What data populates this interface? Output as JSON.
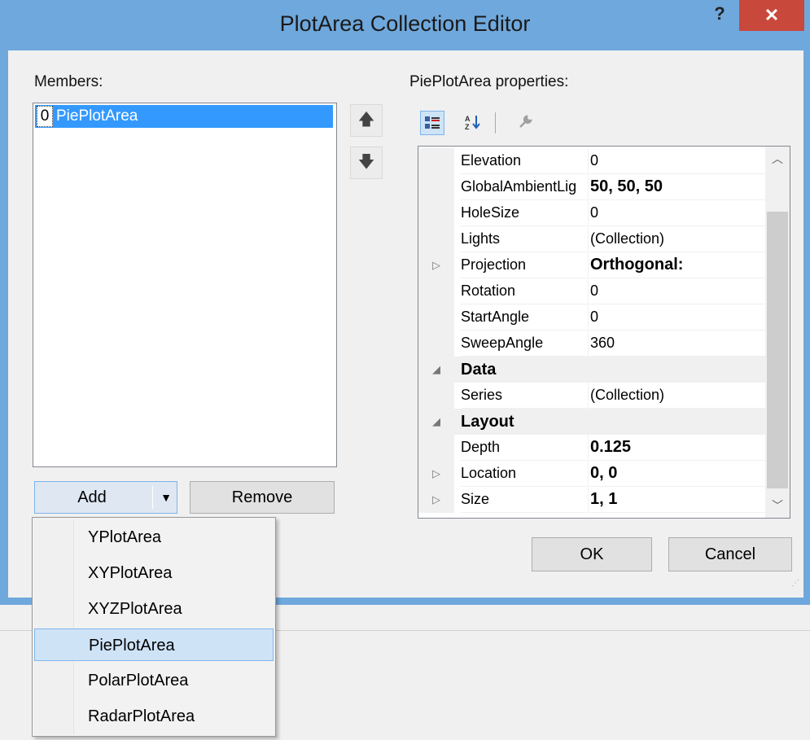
{
  "window": {
    "title": "PlotArea Collection Editor",
    "help_label": "?",
    "close_label": "✕"
  },
  "members": {
    "label": "Members:",
    "items": [
      {
        "index": "0",
        "name": "PiePlotArea"
      }
    ],
    "add_label": "Add",
    "add_dropdown_arrow": "▼",
    "remove_label": "Remove"
  },
  "properties": {
    "label": "PiePlotArea properties:",
    "toolbar": {
      "categorized_icon": "categorized-icon",
      "alphabetical_icon": "alphabetical-icon",
      "property_pages_icon": "wrench-icon"
    },
    "rows": [
      {
        "type": "prop",
        "name": "Elevation",
        "value": "0",
        "bold": false,
        "expander": ""
      },
      {
        "type": "prop",
        "name": "GlobalAmbientLig",
        "value": "50, 50, 50",
        "bold": true,
        "expander": ""
      },
      {
        "type": "prop",
        "name": "HoleSize",
        "value": "0",
        "bold": false,
        "expander": ""
      },
      {
        "type": "prop",
        "name": "Lights",
        "value": "(Collection)",
        "bold": false,
        "expander": ""
      },
      {
        "type": "prop",
        "name": "Projection",
        "value": "Orthogonal:",
        "bold": true,
        "expander": "▷"
      },
      {
        "type": "prop",
        "name": "Rotation",
        "value": "0",
        "bold": false,
        "expander": ""
      },
      {
        "type": "prop",
        "name": "StartAngle",
        "value": "0",
        "bold": false,
        "expander": ""
      },
      {
        "type": "prop",
        "name": "SweepAngle",
        "value": "360",
        "bold": false,
        "expander": ""
      },
      {
        "type": "category",
        "name": "Data",
        "expander": "◢"
      },
      {
        "type": "prop",
        "name": "Series",
        "value": "(Collection)",
        "bold": false,
        "expander": ""
      },
      {
        "type": "category",
        "name": "Layout",
        "expander": "◢"
      },
      {
        "type": "prop",
        "name": "Depth",
        "value": "0.125",
        "bold": true,
        "expander": ""
      },
      {
        "type": "prop",
        "name": "Location",
        "value": "0, 0",
        "bold": true,
        "expander": "▷"
      },
      {
        "type": "prop",
        "name": "Size",
        "value": "1, 1",
        "bold": true,
        "expander": "▷"
      }
    ]
  },
  "buttons": {
    "ok": "OK",
    "cancel": "Cancel"
  },
  "add_menu": {
    "items": [
      "YPlotArea",
      "XYPlotArea",
      "XYZPlotArea",
      "PiePlotArea",
      "PolarPlotArea",
      "RadarPlotArea"
    ],
    "hovered": "PiePlotArea"
  },
  "colors": {
    "title_bar": "#6fa8dc",
    "close_button": "#c9483c",
    "selection": "#3399ff",
    "menu_hover": "#cfe3f7"
  }
}
